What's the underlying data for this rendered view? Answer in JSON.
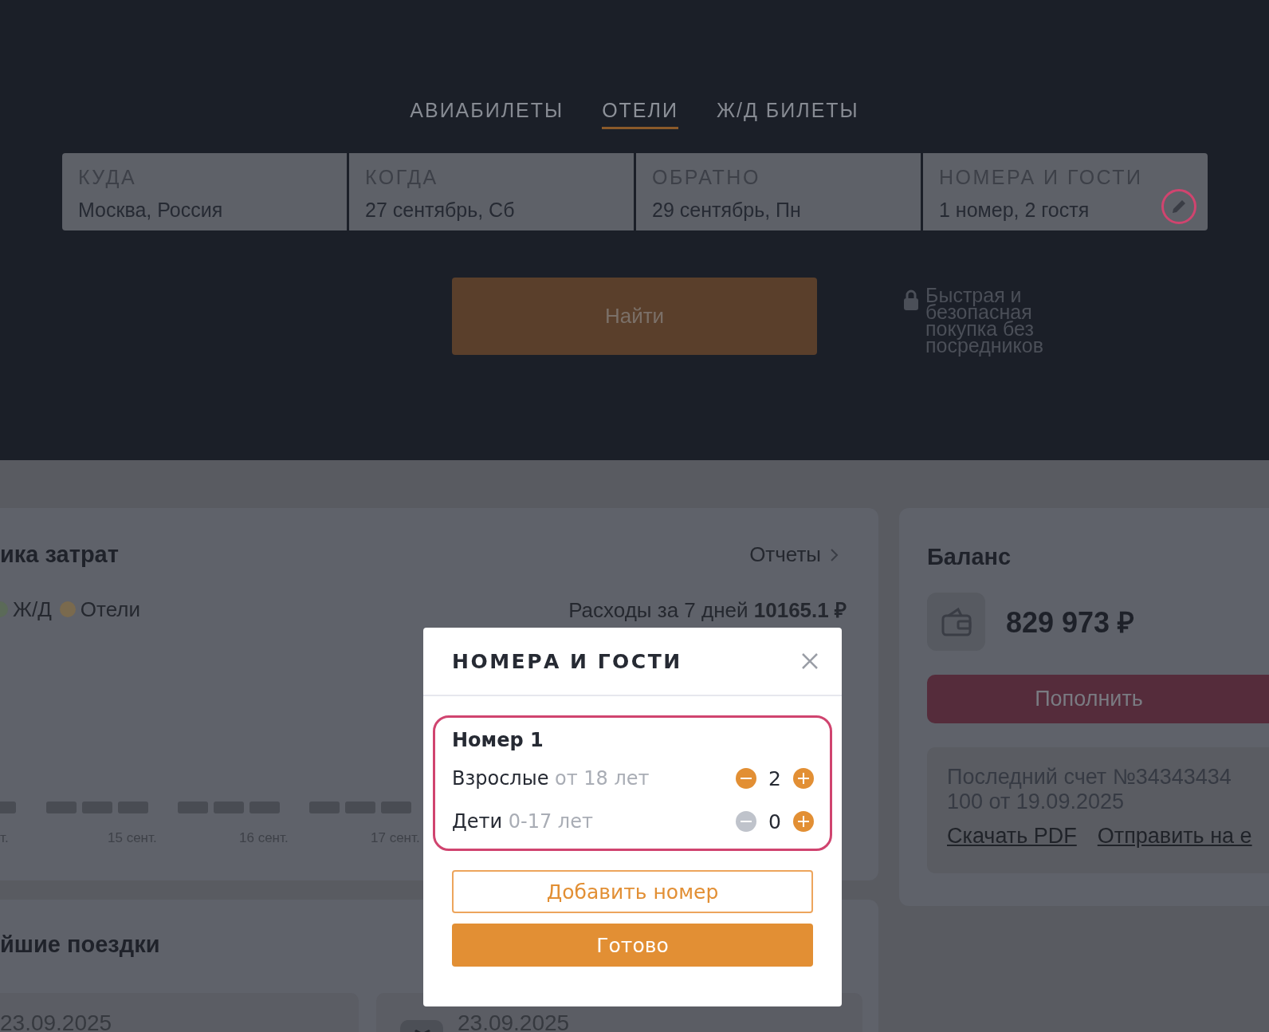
{
  "tabs": [
    {
      "label": "АВИАБИЛЕТЫ",
      "selected": false
    },
    {
      "label": "ОТЕЛИ",
      "selected": true
    },
    {
      "label": "Ж/Д БИЛЕТЫ",
      "selected": false
    }
  ],
  "search_fields": [
    {
      "label": "КУДА",
      "value": "Москва, Россия",
      "editable": false
    },
    {
      "label": "КОГДА",
      "value": "27 сентябрь, Сб",
      "editable": false
    },
    {
      "label": "ОБРАТНО",
      "value": "29 сентябрь, Пн",
      "editable": false
    },
    {
      "label": "НОМЕРА И ГОСТИ",
      "value": "1 номер, 2 гостя",
      "editable": true
    }
  ],
  "find_button": "Найти",
  "secure_note": [
    "Быстрая и",
    "безопасная",
    "покупка без",
    "посредников"
  ],
  "expenses": {
    "title": "ика затрат",
    "reports_link": "Отчеты",
    "legend": [
      {
        "label": "Ж/Д",
        "color": "#5b6a58"
      },
      {
        "label": "Отели",
        "color": "#7a6a4e"
      }
    ],
    "total_label": "Расходы за 7 дней **10165.1 ₽**",
    "chart_labels": [
      "т.",
      "15 сент.",
      "16 сент.",
      "17 сент."
    ]
  },
  "balance": {
    "title": "Баланс",
    "amount": "829 973 ₽",
    "top_up_button": "Пополнить",
    "invoice_lines": [
      "Последний счет №34343434",
      "100 от 19.09.2025"
    ],
    "links": [
      "Скачать PDF",
      "Отправить на е"
    ]
  },
  "trips": {
    "title": "йшие поездки",
    "cards": [
      {
        "date": "23.09.2025",
        "kind": "plain"
      },
      {
        "date": "23.09.2025",
        "kind": "flight"
      }
    ]
  },
  "modal": {
    "title": "НОМЕРА И ГОСТИ",
    "rooms": [
      {
        "title": "Номер 1",
        "guests": [
          {
            "label": "Взрослые",
            "hint": "от 18 лет",
            "count": "2",
            "minus_disabled": false,
            "plus_disabled": false
          },
          {
            "label": "Дети",
            "hint": "0-17 лет",
            "count": "0",
            "minus_disabled": true,
            "plus_disabled": false
          }
        ]
      }
    ],
    "add_button": "Добавить номер",
    "done_button": "Готово"
  }
}
